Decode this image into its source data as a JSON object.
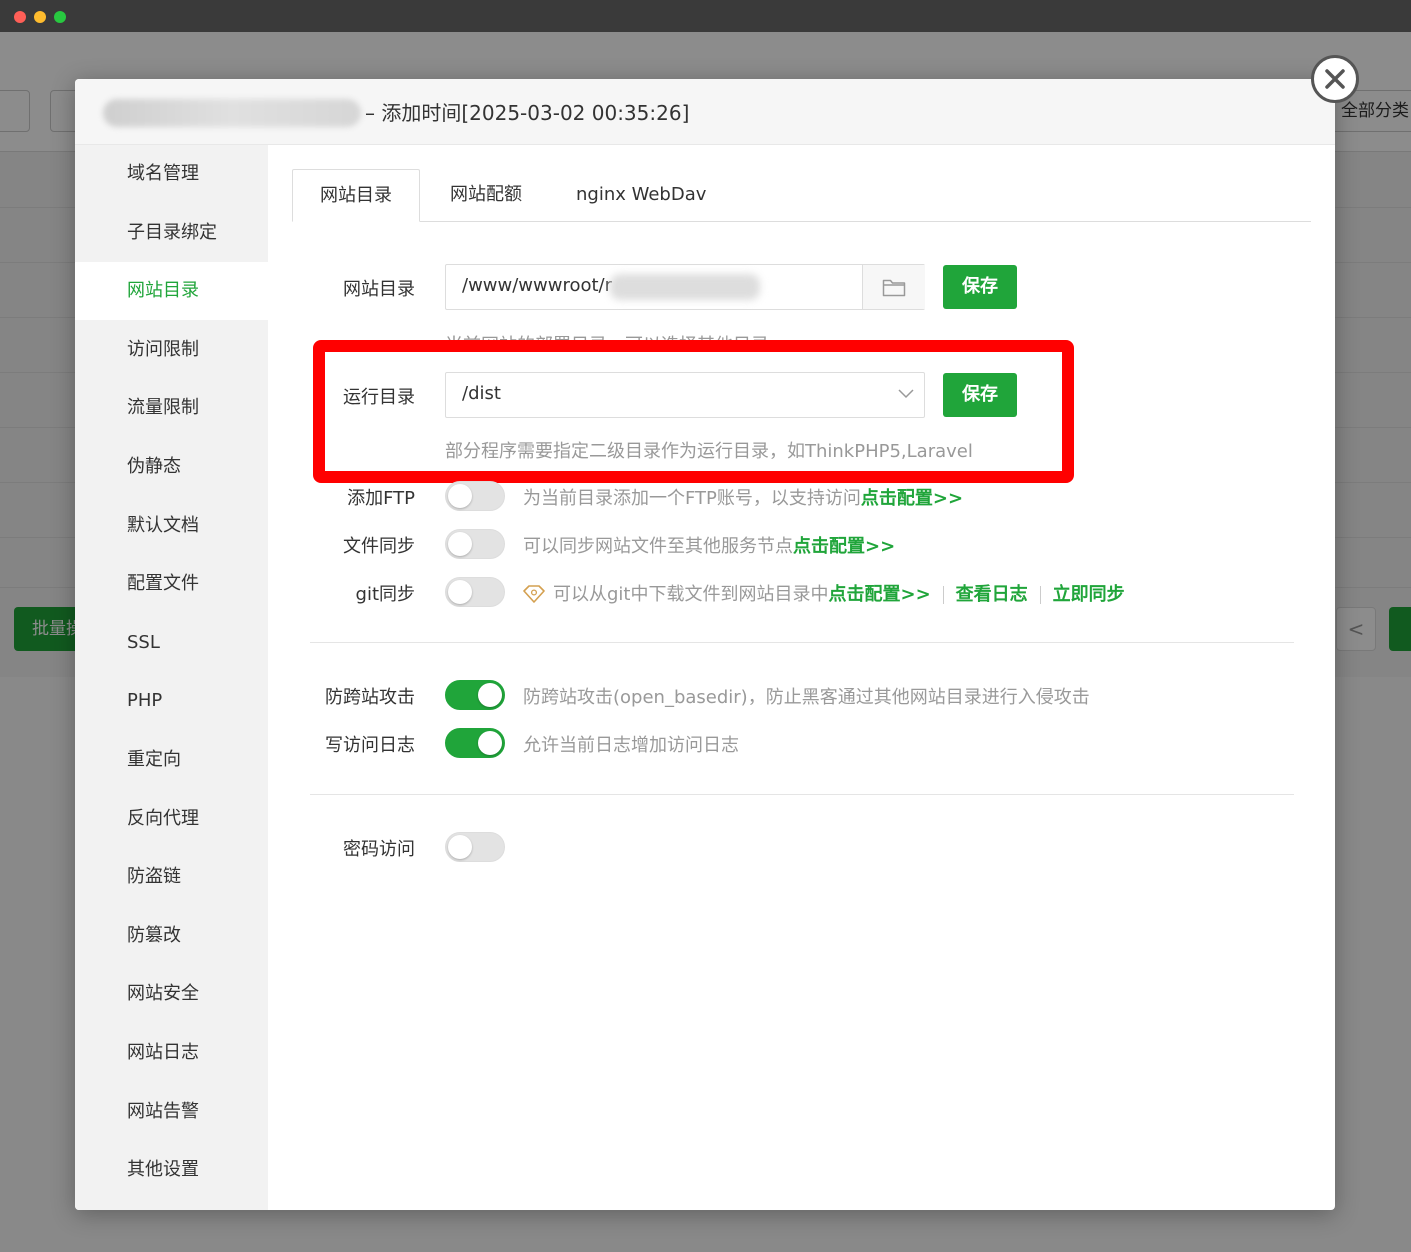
{
  "backdrop": {
    "all_category": "全部分类",
    "batch_label": "批量操作",
    "prev_label": "<"
  },
  "dialog": {
    "title": "– 添加时间[2025-03-02 00:35:26]"
  },
  "sidebar": {
    "items": [
      {
        "label": "域名管理"
      },
      {
        "label": "子目录绑定"
      },
      {
        "label": "网站目录"
      },
      {
        "label": "访问限制"
      },
      {
        "label": "流量限制"
      },
      {
        "label": "伪静态"
      },
      {
        "label": "默认文档"
      },
      {
        "label": "配置文件"
      },
      {
        "label": "SSL"
      },
      {
        "label": "PHP"
      },
      {
        "label": "重定向"
      },
      {
        "label": "反向代理"
      },
      {
        "label": "防盗链"
      },
      {
        "label": "防篡改"
      },
      {
        "label": "网站安全"
      },
      {
        "label": "网站日志"
      },
      {
        "label": "网站告警"
      },
      {
        "label": "其他设置"
      }
    ],
    "active_index": 2
  },
  "tabs": [
    {
      "label": "网站目录"
    },
    {
      "label": "网站配额"
    },
    {
      "label": "nginx WebDav"
    }
  ],
  "form": {
    "site_dir": {
      "label": "网站目录",
      "value": "/www/wwwroot/r",
      "hint": "当前网站的部署目录，可以选择其他目录",
      "save_label": "保存"
    },
    "run_dir": {
      "label": "运行目录",
      "value": "/dist",
      "hint": "部分程序需要指定二级目录作为运行目录，如ThinkPHP5,Laravel",
      "save_label": "保存"
    },
    "ftp": {
      "label": "添加FTP",
      "on": false,
      "desc": "为当前目录添加一个FTP账号，以支持访问",
      "link": "点击配置>>"
    },
    "file_sync": {
      "label": "文件同步",
      "on": false,
      "desc": "可以同步网站文件至其他服务节点",
      "link": "点击配置>>"
    },
    "git_sync": {
      "label": "git同步",
      "on": false,
      "desc": "可以从git中下载文件到网站目录中",
      "link": "点击配置>>",
      "view_log": "查看日志",
      "sync_now": "立即同步"
    },
    "anti_xss": {
      "label": "防跨站攻击",
      "on": true,
      "desc": "防跨站攻击(open_basedir)，防止黑客通过其他网站目录进行入侵攻击"
    },
    "access_log": {
      "label": "写访问日志",
      "on": true,
      "desc": "允许当前日志增加访问日志"
    },
    "password_access": {
      "label": "密码访问",
      "on": false
    }
  },
  "colors": {
    "accent": "#20a53a",
    "highlight": "#ff0000"
  }
}
